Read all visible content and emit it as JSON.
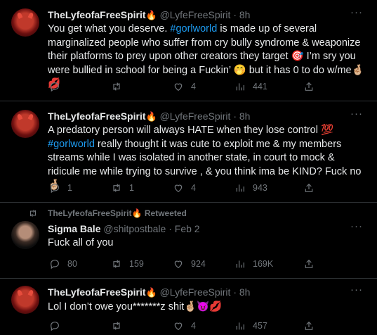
{
  "tweets": [
    {
      "name": "TheLyfeofaFreeSpirit",
      "name_emoji": "🔥",
      "handle": "@LyfeFreeSpirit",
      "dot": "·",
      "time": "8h",
      "text_parts": {
        "p1": "You get what you deserve. ",
        "tag1": "#gorlworld",
        "p2": " is made up of several marginalized people who suffer from cry bully syndrome & weaponize their platforms to prey upon other creators they target 🎯 I’m sry you were bullied in school for being a Fuckin’ 🤭 but it has 0 to do w/me🤞🏼💋"
      },
      "replies": "",
      "retweets": "",
      "likes": "4",
      "views": "441"
    },
    {
      "name": "TheLyfeofaFreeSpirit",
      "name_emoji": "🔥",
      "handle": "@LyfeFreeSpirit",
      "dot": "·",
      "time": "8h",
      "text_parts": {
        "p1": "A predatory person will always HATE when they lose control 💯 ",
        "tag1": "#gorlworld",
        "p2": " really thought it was cute to exploit me & my members streams while I was isolated in another state, in court  to mock & ridicule me while trying to survive , & you think ima be KIND? Fuck no 🤞🏼"
      },
      "replies": "1",
      "retweets": "1",
      "likes": "4",
      "views": "943"
    },
    {
      "retweeted_by": "TheLyfeofaFreeSpirit🔥 Retweeted",
      "name": "Sigma Bale",
      "name_emoji": "",
      "handle": "@shitpostbale",
      "dot": "·",
      "time": "Feb 2",
      "text": "Fuck all of you",
      "replies": "80",
      "retweets": "159",
      "likes": "924",
      "views": "169K"
    },
    {
      "name": "TheLyfeofaFreeSpirit",
      "name_emoji": "🔥",
      "handle": "@LyfeFreeSpirit",
      "dot": "·",
      "time": "8h",
      "text": "Lol I don’t owe you*******z shit🤞🏼😈💋",
      "replies": "",
      "retweets": "",
      "likes": "4",
      "views": "457"
    }
  ],
  "icons": [
    "reply-icon",
    "retweet-icon",
    "like-icon",
    "views-icon",
    "share-icon",
    "more-icon"
  ],
  "colors": {
    "background": "#000000",
    "text": "#e7e9ea",
    "muted": "#71767b",
    "link": "#1d9bf0",
    "divider": "#2f3336"
  }
}
